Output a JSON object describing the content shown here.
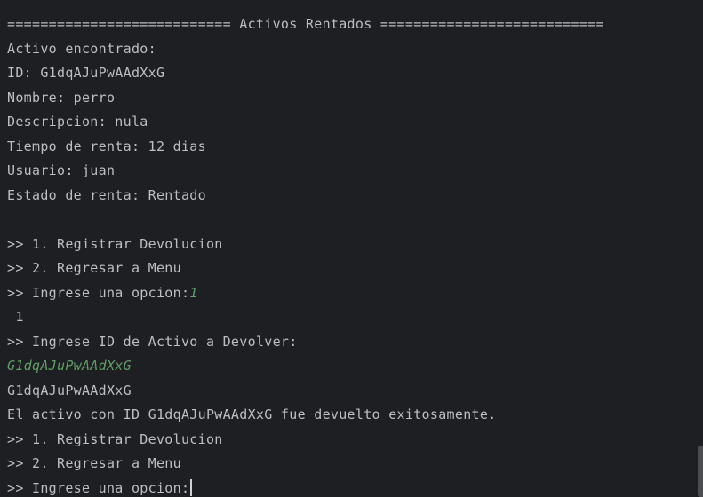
{
  "console": {
    "header": "=========================== Activos Rentados ===========================",
    "found_label": "Activo encontrado:",
    "id_line": "ID: G1dqAJuPwAAdXxG",
    "nombre_line": "Nombre: perro",
    "descripcion_line": "Descripcion: nula",
    "tiempo_line": "Tiempo de renta: 12 dias",
    "usuario_line": "Usuario: juan",
    "estado_line": "Estado de renta: Rentado",
    "menu1_option1": ">> 1. Registrar Devolucion",
    "menu1_option2": ">> 2. Regresar a Menu",
    "menu1_prompt": ">> Ingrese una opcion:",
    "menu1_user_input": "1",
    "menu1_echo": " 1",
    "id_prompt": ">> Ingrese ID de Activo a Devolver:",
    "id_user_input": "G1dqAJuPwAAdXxG",
    "id_echo": "G1dqAJuPwAAdXxG",
    "success_message": "El activo con ID G1dqAJuPwAAdXxG fue devuelto exitosamente.",
    "menu2_option1": ">> 1. Registrar Devolucion",
    "menu2_option2": ">> 2. Regresar a Menu",
    "menu2_prompt": ">> Ingrese una opcion:"
  },
  "colors": {
    "background": "#1e1f22",
    "output_text": "#bcbec4",
    "user_input": "#5f9e65"
  }
}
